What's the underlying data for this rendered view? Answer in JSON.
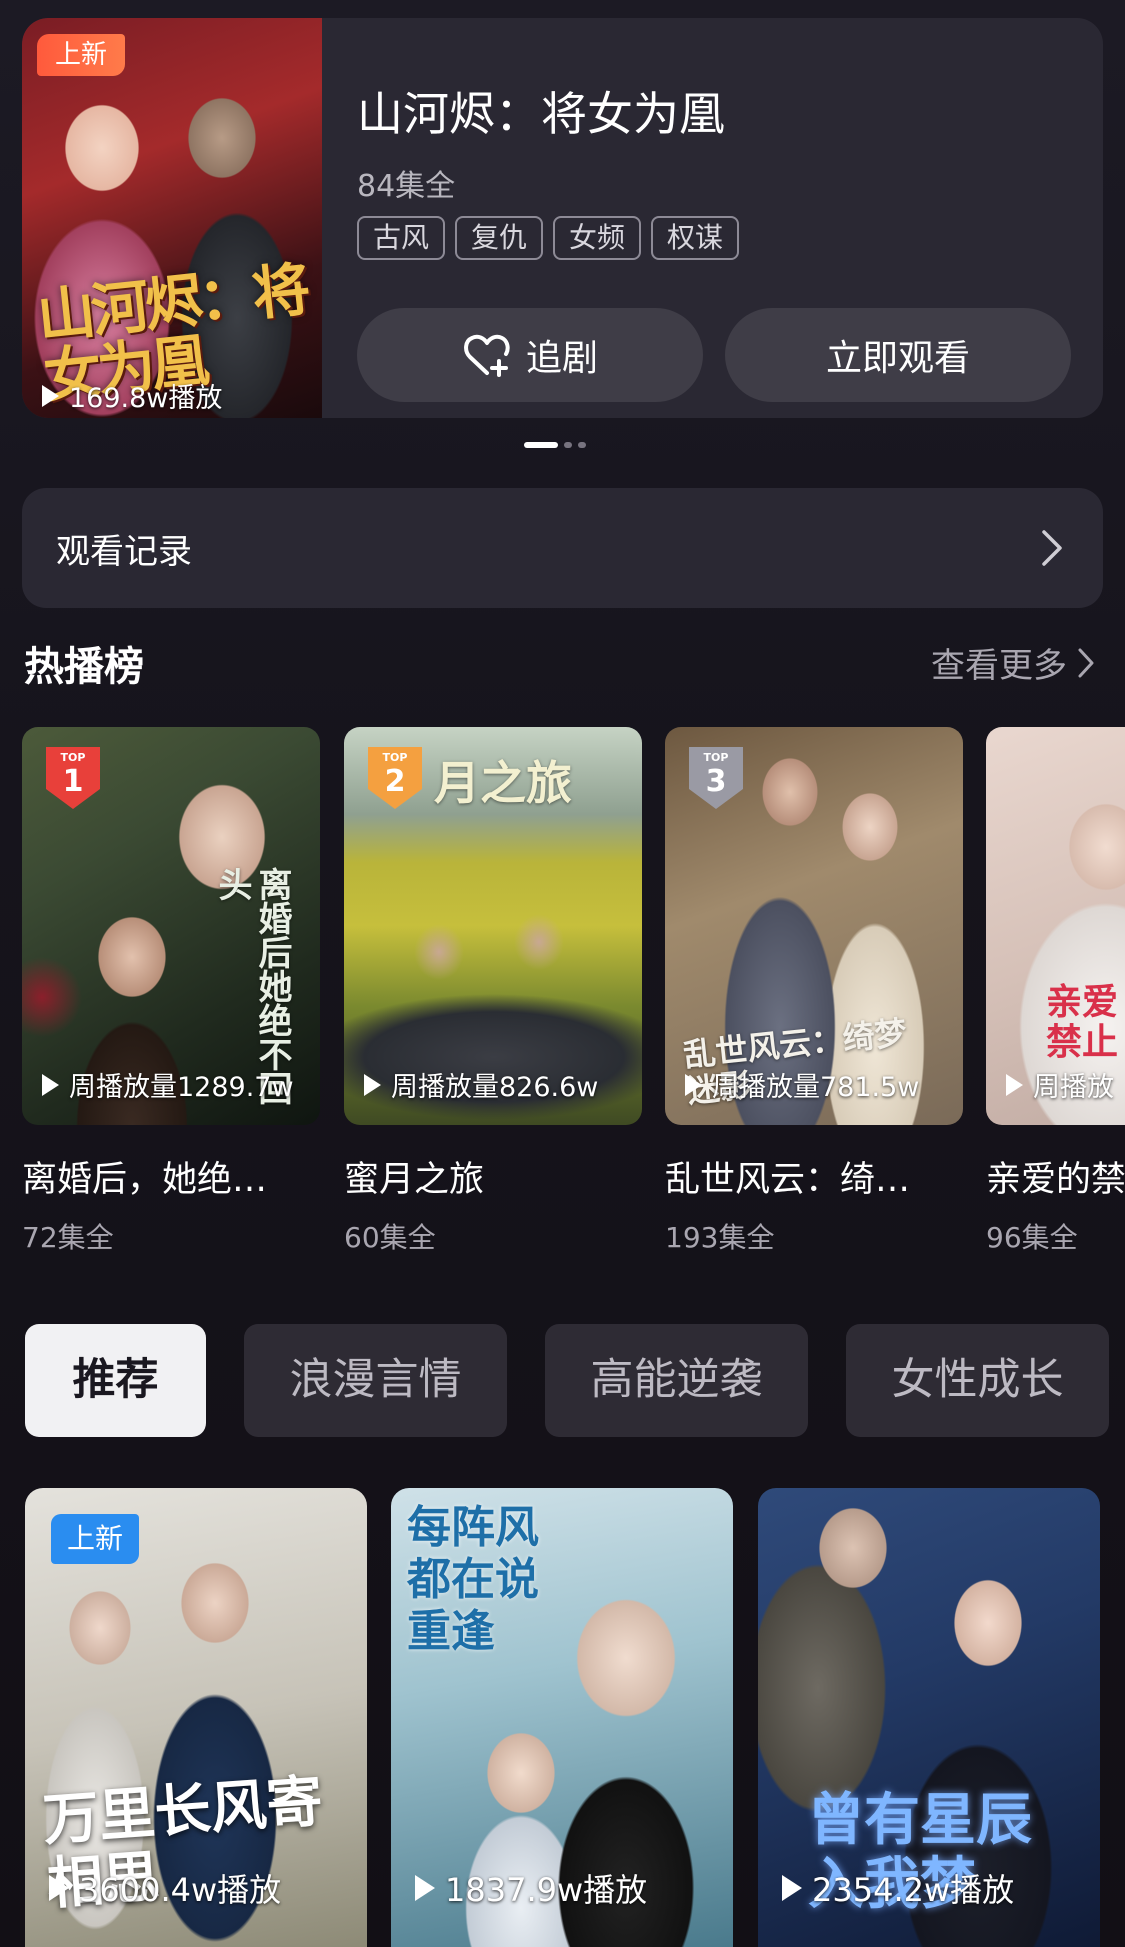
{
  "featured": {
    "badge": "上新",
    "poster_art": "山河烬：将女为凰",
    "play_count": "169.8w播放",
    "title": "山河烬：将女为凰",
    "episodes": "84集全",
    "tags": [
      "古风",
      "复仇",
      "女频",
      "权谋"
    ],
    "follow_label": "追剧",
    "watch_label": "立即观看",
    "carousel_index": 1,
    "carousel_count": 3
  },
  "history": {
    "label": "观看记录"
  },
  "hot_list": {
    "title": "热播榜",
    "more_label": "查看更多",
    "items": [
      {
        "rank": "1",
        "rank_label": "TOP",
        "play_count": "周播放量1289.7w",
        "name": "离婚后，她绝…",
        "episodes": "72集全",
        "art": "离婚后她绝不回头"
      },
      {
        "rank": "2",
        "rank_label": "TOP",
        "play_count": "周播放量826.6w",
        "name": "蜜月之旅",
        "episodes": "60集全",
        "art": "月之旅"
      },
      {
        "rank": "3",
        "rank_label": "TOP",
        "play_count": "周播放量781.5w",
        "name": "乱世风云：绮…",
        "episodes": "193集全",
        "art": "乱世风云：绮梦迷影"
      },
      {
        "rank": "",
        "rank_label": "",
        "play_count": "周播放",
        "name": "亲爱的禁",
        "episodes": "96集全",
        "art": "亲爱禁止"
      }
    ]
  },
  "categories": [
    "推荐",
    "浪漫言情",
    "高能逆袭",
    "女性成长"
  ],
  "recommend": [
    {
      "badge": "上新",
      "play_count": "3600.4w播放",
      "art": "万里长风寄相思"
    },
    {
      "badge": "",
      "play_count": "1837.9w播放",
      "art": "每阵风都在说重逢"
    },
    {
      "badge": "",
      "play_count": "2354.2w播放",
      "art": "曾有星辰入我梦"
    }
  ],
  "colors": {
    "background": "#16141c",
    "card": "#2a2833",
    "badge_new": "#ff5a3c",
    "badge_new_blue": "#2a8df0",
    "rank1": "#e8403a",
    "rank2": "#f4a040",
    "rank3": "#9a9aa4"
  }
}
